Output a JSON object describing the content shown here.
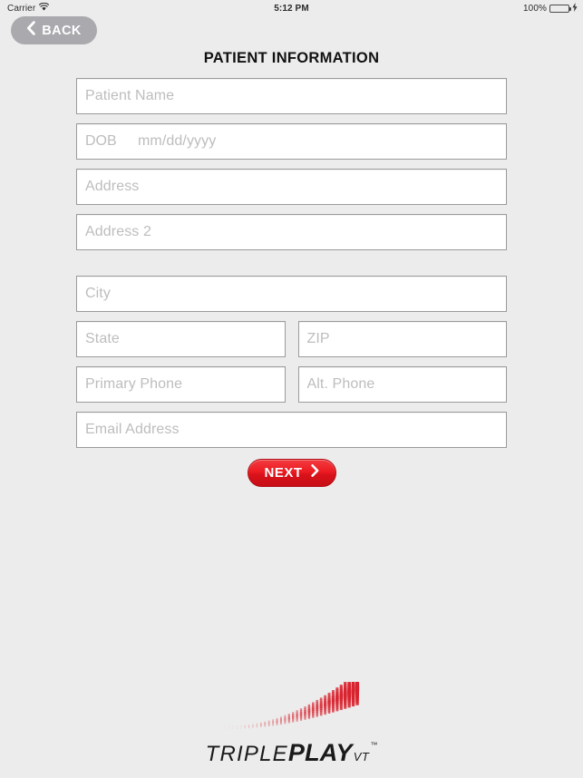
{
  "status_bar": {
    "carrier": "Carrier",
    "wifi_icon": "wifi-icon",
    "time": "5:12 PM",
    "battery_percent": "100%",
    "battery_icon": "battery-icon",
    "charging_icon": "charging-bolt-icon",
    "battery_color": "#4cd964"
  },
  "nav": {
    "back_label": "BACK",
    "back_icon": "chevron-left-icon",
    "back_color": "#aaa9ae"
  },
  "header": {
    "title": "PATIENT INFORMATION"
  },
  "form": {
    "fields": [
      {
        "name": "patient-name",
        "placeholder": "Patient Name",
        "value": "",
        "width": "full"
      },
      {
        "name": "dob",
        "label": "DOB",
        "placeholder": "mm/dd/yyyy",
        "value": "",
        "width": "full"
      },
      {
        "name": "address",
        "placeholder": "Address",
        "value": "",
        "width": "full"
      },
      {
        "name": "address-2",
        "placeholder": "Address 2",
        "value": "",
        "width": "full"
      },
      {
        "name": "city",
        "placeholder": "City",
        "value": "",
        "width": "full"
      },
      {
        "name": "state",
        "placeholder": "State",
        "value": "",
        "width": "half"
      },
      {
        "name": "zip",
        "placeholder": "ZIP",
        "value": "",
        "width": "half"
      },
      {
        "name": "primary-phone",
        "placeholder": "Primary Phone",
        "value": "",
        "width": "half"
      },
      {
        "name": "alt-phone",
        "placeholder": "Alt. Phone",
        "value": "",
        "width": "half"
      },
      {
        "name": "email-address",
        "placeholder": "Email Address",
        "value": "",
        "width": "full"
      }
    ]
  },
  "actions": {
    "next_label": "NEXT",
    "next_icon": "chevron-right-icon",
    "next_color": "#ec1c23"
  },
  "logo": {
    "text_triple": "TRIPLE",
    "text_play": "PLAY",
    "text_vt": "VT",
    "trademark": "™",
    "swoosh_color": "#d9232e"
  },
  "theme": {
    "background": "#ececec",
    "field_background": "#ffffff",
    "field_border": "#9b9b9b",
    "placeholder_color": "#bdbdbd",
    "title_color": "#111111"
  }
}
